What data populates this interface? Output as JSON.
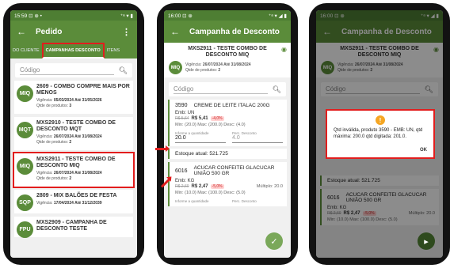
{
  "phone1": {
    "status": {
      "time": "15:59",
      "icons": "⊡ ⊕ •",
      "right": "⁺ᵃ ▾ ▮"
    },
    "appbar": {
      "title": "Pedido",
      "menu": "⋮"
    },
    "tabs": [
      {
        "label": "DO CLIENTE"
      },
      {
        "label": "CAMPANHAS DESCONTO"
      },
      {
        "label": "ITENS"
      }
    ],
    "search": {
      "placeholder": "Código"
    },
    "campaigns": [
      {
        "avatar": "MIQ",
        "title": "2609 - COMBO COMPRE MAIS POR MENOS",
        "validity_label": "Vigência:",
        "validity": "05/03/2024 Até 31/05/2026",
        "qty_label": "Qtde de produtos:",
        "qty": "3"
      },
      {
        "avatar": "MQT",
        "title": "MXS2910 - TESTE COMBO DE DESCONTO MQT",
        "validity_label": "Vigência:",
        "validity": "26/07/2024 Até 31/08/2024",
        "qty_label": "Qtde de produtos:",
        "qty": "2"
      },
      {
        "avatar": "MIQ",
        "title": "MXS2911 - TESTE COMBO DE DESCONTO MIQ",
        "validity_label": "Vigência:",
        "validity": "26/07/2024 Até 31/08/2024",
        "qty_label": "Qtde de produtos:",
        "qty": "2"
      },
      {
        "avatar": "SQP",
        "title": "2809 - MIX BALÕES DE FESTA",
        "validity_label": "Vigência:",
        "validity": "17/04/2024 Até 31/12/2039",
        "qty_label": "",
        "qty": ""
      },
      {
        "avatar": "FPU",
        "title": "MXS2909 - CAMPANHA DE DESCONTO TESTE",
        "validity_label": "",
        "validity": "",
        "qty_label": "",
        "qty": ""
      }
    ]
  },
  "phone2": {
    "status": {
      "time": "16:00",
      "icons": "⊡ ⊕",
      "right": "⁺ᵃ ▾ ◢ ▮"
    },
    "appbar": {
      "title": "Campanha de Desconto"
    },
    "header": {
      "title": "MXS2911 - TESTE COMBO DE DESCONTO MIQ",
      "avatar": "MIQ",
      "validity_label": "Vigência:",
      "validity": "26/07/2024 Até 31/08/2024",
      "qty_label": "Qtde de produtos:",
      "qty": "2"
    },
    "search": {
      "placeholder": "Código"
    },
    "product1": {
      "code": "3590",
      "name": "CREME DE LEITE ITALAC 200G",
      "emb": "Emb: UN",
      "old_price": "R$ 5,64",
      "new_price": "R$ 5,41",
      "discount": "-4,0%",
      "minmax": "Min: (20.0) Max: (200.0) Desc: (4.0)",
      "qty_label": "Informe a quantidade",
      "qty_value": "20.0",
      "disc_label": "Perc. Desconto",
      "disc_value": "4.0",
      "stock": "Estoque atual: 521.725"
    },
    "product2": {
      "code": "6016",
      "name": "ACUCAR CONFEITEI GLACUCAR UNIÃO 500 GR",
      "emb": "Emb: KG",
      "old_price": "R$ 2,60",
      "new_price": "R$ 2,47",
      "discount": "-5,0%",
      "multi": "Múltiplo: 20.0",
      "minmax": "Min: (10.0) Max: (100.0) Desc: (5.0)",
      "qty_label": "Informe a quantidade",
      "disc_label": "Perc. Desconto"
    },
    "fab": "✓"
  },
  "phone3": {
    "status": {
      "time": "16:00",
      "icons": "⊡ ⊕",
      "right": "⁺ᵃ ▾ ◢ ▮"
    },
    "appbar": {
      "title": "Campanha de Desconto"
    },
    "header": {
      "title": "MXS2911 - TESTE COMBO DE DESCONTO MIQ",
      "avatar": "MIQ",
      "validity_label": "Vigência:",
      "validity": "26/07/2024 Até 31/08/2024",
      "qty_label": "Qtde de produtos:",
      "qty": "2"
    },
    "search": {
      "placeholder": "Código"
    },
    "stock": "Estoque atual: 521.725",
    "product2": {
      "code": "6016",
      "name": "ACUCAR CONFEITEI GLACUCAR UNIÃO 500 GR",
      "emb": "Emb: KG",
      "old_price": "R$ 2,60",
      "new_price": "R$ 2,47",
      "discount": "-5,0%",
      "multi": "Múltiplo: 20.0",
      "minmax": "Min: (10.0) Max: (100.0) Desc: (5.0)"
    },
    "dialog": {
      "icon": "!",
      "message": "Qtd inválida, produto 3590 - EMB: UN, qtd máxima: 200.0 qtd digitada: 201.0.",
      "ok": "OK"
    },
    "fab": "▸"
  },
  "colors": {
    "primary": "#5b8c3a",
    "status": "#4e7e33",
    "highlight": "#e21d1d",
    "warning": "#f5a623"
  }
}
